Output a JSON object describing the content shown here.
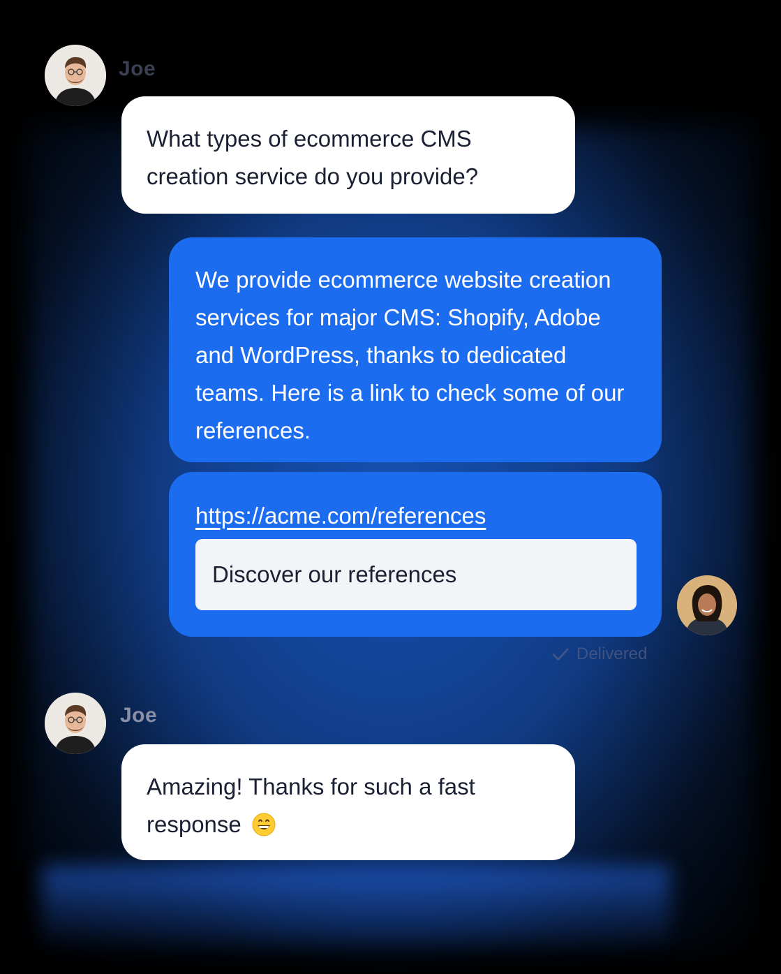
{
  "chat": {
    "messages": [
      {
        "sender": "Joe",
        "text": "What types of ecommerce CMS creation service do you provide?"
      },
      {
        "text": "We provide ecommerce website creation services for major CMS: Shopify, Adobe and WordPress, thanks to dedicated teams. Here is a link to check some of our references."
      },
      {
        "link": "https://acme.com/references",
        "button_label": "Discover our references",
        "status": "Delivered"
      },
      {
        "sender": "Joe",
        "text": "Amazing! Thanks for such a fast response"
      }
    ]
  },
  "icons": {
    "check": "check-icon",
    "emoji": "grinning-face-emoji-icon"
  },
  "colors": {
    "agent_bubble": "#1c6cf0",
    "user_bubble": "#ffffff",
    "button_bg": "#f3f4f8",
    "text_dark": "#1b2133"
  }
}
